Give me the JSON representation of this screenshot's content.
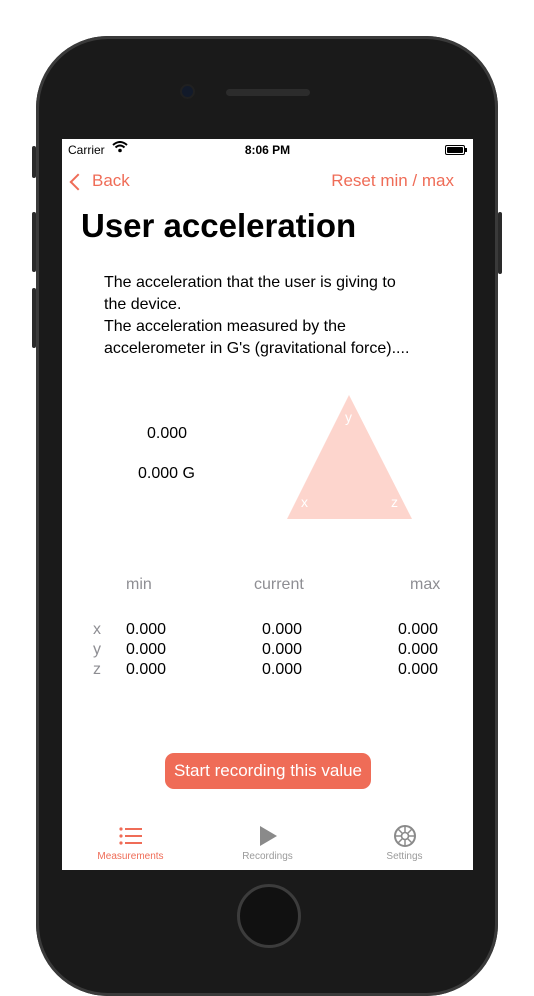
{
  "status": {
    "carrier": "Carrier",
    "time": "8:06 PM"
  },
  "nav": {
    "back_label": "Back",
    "reset_label": "Reset min / max"
  },
  "title": "User acceleration",
  "description_lines": [
    "The acceleration that the user is giving to",
    "the device.",
    "The acceleration measured by the",
    "accelerometer in G's (gravitational force)...."
  ],
  "values": {
    "value": "0.000",
    "g_value": "0.000 G"
  },
  "triangle": {
    "top": "y",
    "left": "x",
    "right": "z",
    "color": "#fdd5cd"
  },
  "table": {
    "headers": {
      "min": "min",
      "current": "current",
      "max": "max"
    },
    "rows": [
      {
        "axis": "x",
        "min": "0.000",
        "current": "0.000",
        "max": "0.000"
      },
      {
        "axis": "y",
        "min": "0.000",
        "current": "0.000",
        "max": "0.000"
      },
      {
        "axis": "z",
        "min": "0.000",
        "current": "0.000",
        "max": "0.000"
      }
    ]
  },
  "record_button": "Start recording this value",
  "tabs": [
    {
      "label": "Measurements",
      "icon": "list-icon",
      "active": true
    },
    {
      "label": "Recordings",
      "icon": "play-icon",
      "active": false
    },
    {
      "label": "Settings",
      "icon": "gear-icon",
      "active": false
    }
  ],
  "colors": {
    "accent": "#ef6c57",
    "secondary_text": "#8e8e93"
  }
}
